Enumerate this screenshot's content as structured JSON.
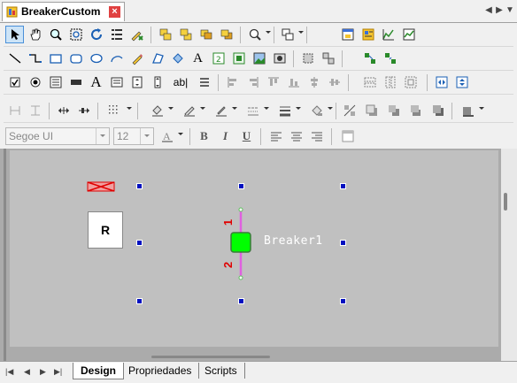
{
  "document": {
    "title": "BreakerCustom",
    "close_label": "×",
    "nav_prev": "◀",
    "nav_next": "▶",
    "nav_menu": "▼"
  },
  "toolbar": {
    "font_name": "Segoe UI",
    "font_size": "12",
    "bold_label": "B",
    "italic_label": "I",
    "underline_label": "U",
    "text_tool_label": "A",
    "textfield_tool_label": "ab|"
  },
  "canvas": {
    "r_element_label": "R",
    "breaker_label": "Breaker1",
    "pin1_label": "1",
    "pin2_label": "2",
    "breaker_color": "#00ff00",
    "connector_color": "#e060e0"
  },
  "bottom_tabs": {
    "nav_first": "|◀",
    "nav_prev": "◀",
    "nav_next": "▶",
    "nav_last": "▶|",
    "tabs": [
      {
        "label": "Design"
      },
      {
        "label": "Propriedades"
      },
      {
        "label": "Scripts"
      }
    ]
  },
  "colors": {
    "surface": "#c0c0c0",
    "handle": "#0010c0",
    "selected_tool_bg": "#cde4f7"
  }
}
